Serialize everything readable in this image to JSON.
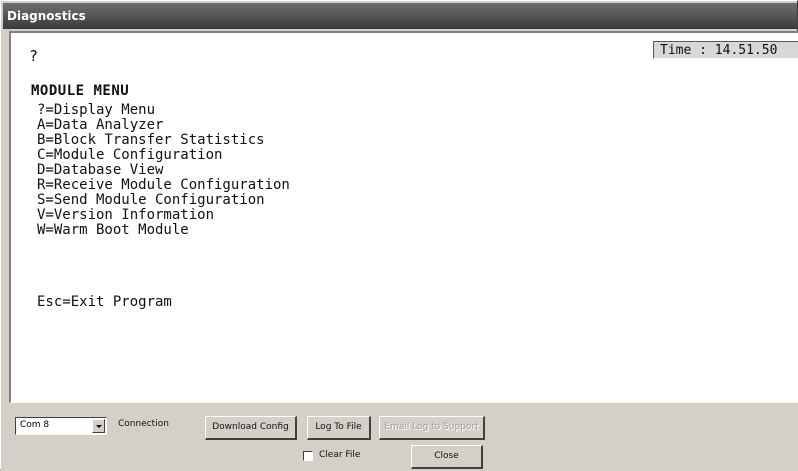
{
  "window": {
    "title": "Diagnostics"
  },
  "terminal": {
    "time": "Time : 14.51.50",
    "prompt": "?",
    "menu_title": "MODULE MENU",
    "menu_items": [
      "?=Display Menu",
      "A=Data Analyzer",
      "B=Block Transfer Statistics",
      "C=Module Configuration",
      "D=Database View",
      "R=Receive Module Configuration",
      "S=Send Module Configuration",
      "V=Version Information",
      "W=Warm Boot Module"
    ],
    "exit": "Esc=Exit Program"
  },
  "controls": {
    "port_select": {
      "value": "Com 8",
      "icon": "chevron-down-icon"
    },
    "connection_label": "Connection",
    "download_config": "Download Config",
    "log_to_file": "Log To File",
    "email_log": "Email Log to Support",
    "clear_file_label": "Clear File",
    "clear_file_checked": false,
    "close": "Close"
  }
}
